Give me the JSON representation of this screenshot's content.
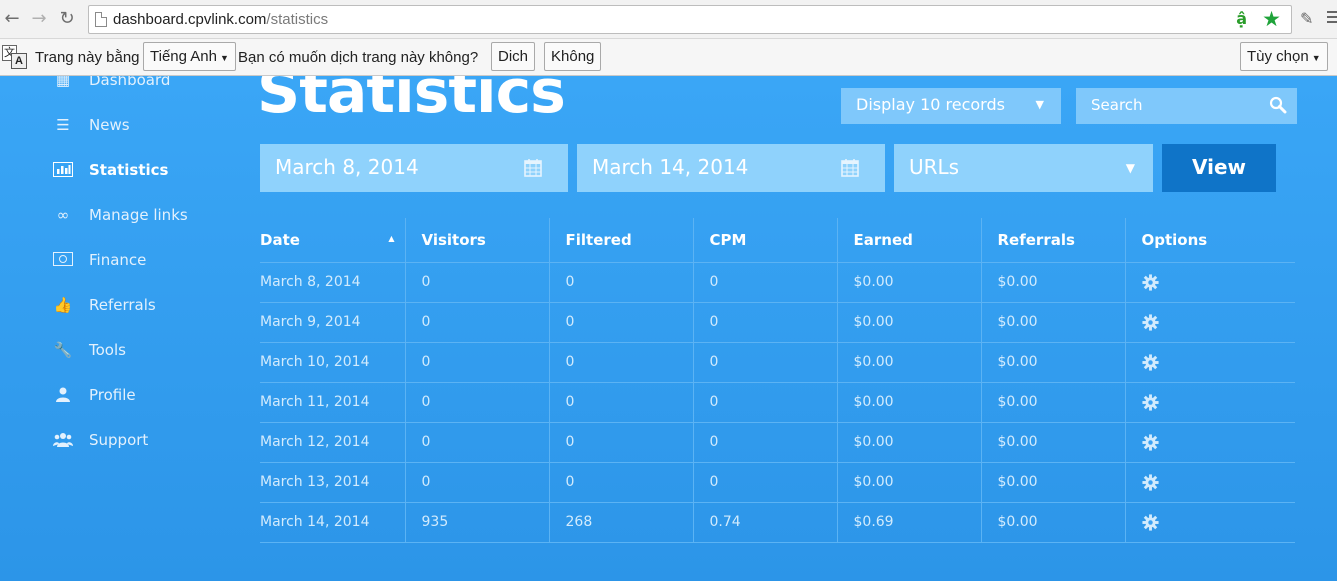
{
  "browser": {
    "url_domain": "dashboard.cpvlink.com",
    "url_path": "/statistics"
  },
  "translate_bar": {
    "prefix": "Trang này bằng",
    "language": "Tiếng Anh",
    "question": "Bạn có muốn dịch trang này không?",
    "translate_button": "Dich",
    "no_button": "Không",
    "options_button": "Tùy chọn"
  },
  "sidebar": {
    "items": [
      {
        "label": "Dashboard",
        "icon": "grid-icon"
      },
      {
        "label": "News",
        "icon": "list-icon"
      },
      {
        "label": "Statistics",
        "icon": "bar-chart-icon",
        "active": true
      },
      {
        "label": "Manage links",
        "icon": "link-icon"
      },
      {
        "label": "Finance",
        "icon": "money-icon"
      },
      {
        "label": "Referrals",
        "icon": "thumbs-up-icon"
      },
      {
        "label": "Tools",
        "icon": "wrench-icon"
      },
      {
        "label": "Profile",
        "icon": "user-icon"
      },
      {
        "label": "Support",
        "icon": "users-icon"
      }
    ]
  },
  "main": {
    "title": "Statistics",
    "display_select": "Display 10 records",
    "search_placeholder": "Search",
    "date_from": "March 8, 2014",
    "date_to": "March 14, 2014",
    "type_select": "URLs",
    "view_button": "View"
  },
  "table": {
    "headers": [
      "Date",
      "Visitors",
      "Filtered",
      "CPM",
      "Earned",
      "Referrals",
      "Options"
    ],
    "rows": [
      [
        "March 8, 2014",
        "0",
        "0",
        "0",
        "$0.00",
        "$0.00"
      ],
      [
        "March 9, 2014",
        "0",
        "0",
        "0",
        "$0.00",
        "$0.00"
      ],
      [
        "March 10, 2014",
        "0",
        "0",
        "0",
        "$0.00",
        "$0.00"
      ],
      [
        "March 11, 2014",
        "0",
        "0",
        "0",
        "$0.00",
        "$0.00"
      ],
      [
        "March 12, 2014",
        "0",
        "0",
        "0",
        "$0.00",
        "$0.00"
      ],
      [
        "March 13, 2014",
        "0",
        "0",
        "0",
        "$0.00",
        "$0.00"
      ],
      [
        "March 14, 2014",
        "935",
        "268",
        "0.74",
        "$0.69",
        "$0.00"
      ]
    ]
  },
  "colors": {
    "background": "#2f9bf0",
    "field": "#8fd2fc",
    "view_button": "#0f74c8"
  }
}
